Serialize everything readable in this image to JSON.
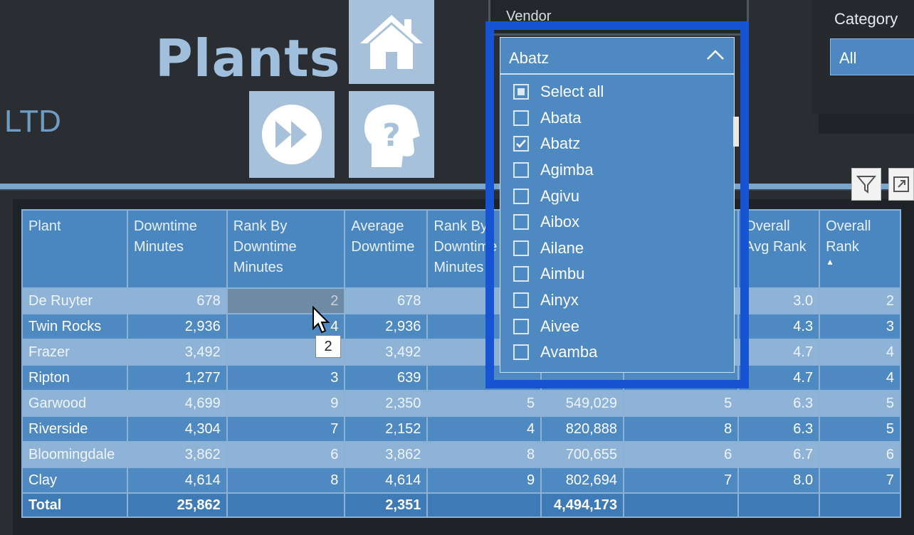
{
  "header": {
    "title": "Plants",
    "company_suffix": "LTD"
  },
  "icons": {
    "home": "home-icon",
    "forward": "fast-forward-icon",
    "help": "help-head-icon",
    "filter": "filter-icon",
    "focus": "focus-mode-icon"
  },
  "vendor_slicer": {
    "label": "Vendor",
    "selected": "Abatz",
    "options": [
      {
        "label": "Select all",
        "state": "partial"
      },
      {
        "label": "Abata",
        "state": "unchecked"
      },
      {
        "label": "Abatz",
        "state": "checked"
      },
      {
        "label": "Agimba",
        "state": "unchecked"
      },
      {
        "label": "Agivu",
        "state": "unchecked"
      },
      {
        "label": "Aibox",
        "state": "unchecked"
      },
      {
        "label": "Ailane",
        "state": "unchecked"
      },
      {
        "label": "Aimbu",
        "state": "unchecked"
      },
      {
        "label": "Ainyx",
        "state": "unchecked"
      },
      {
        "label": "Aivee",
        "state": "unchecked"
      },
      {
        "label": "Avamba",
        "state": "unchecked"
      }
    ]
  },
  "category_slicer": {
    "label": "Category",
    "selected": "All"
  },
  "table": {
    "columns": [
      "Plant",
      "Downtime Minutes",
      "Rank By Downtime Minutes",
      "Average Downtime",
      "Rank By Downtime Minutes",
      "",
      "",
      "Overall Avg Rank",
      "Overall Rank"
    ],
    "rows": [
      [
        "De Ruyter",
        "678",
        "2",
        "678",
        "",
        "",
        "",
        "3.0",
        "2"
      ],
      [
        "Twin Rocks",
        "2,936",
        "4",
        "2,936",
        "",
        "",
        "",
        "4.3",
        "3"
      ],
      [
        "Frazer",
        "3,492",
        "",
        "3,492",
        "",
        "",
        "",
        "4.7",
        "4"
      ],
      [
        "Ripton",
        "1,277",
        "3",
        "639",
        "",
        "",
        "",
        "4.7",
        "4"
      ],
      [
        "Garwood",
        "4,699",
        "9",
        "2,350",
        "5",
        "549,029",
        "5",
        "6.3",
        "5"
      ],
      [
        "Riverside",
        "4,304",
        "7",
        "2,152",
        "4",
        "820,888",
        "8",
        "6.3",
        "5"
      ],
      [
        "Bloomingdale",
        "3,862",
        "6",
        "3,862",
        "8",
        "700,655",
        "6",
        "6.7",
        "6"
      ],
      [
        "Clay",
        "4,614",
        "8",
        "4,614",
        "9",
        "802,694",
        "7",
        "8.0",
        "7"
      ]
    ],
    "total": [
      "Total",
      "25,862",
      "",
      "2,351",
      "",
      "4,494,173",
      "",
      "",
      ""
    ]
  },
  "tooltip": "2"
}
